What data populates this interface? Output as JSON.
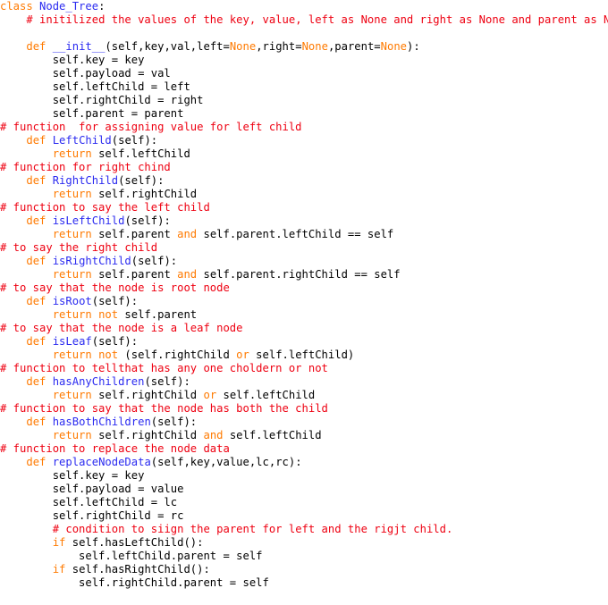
{
  "editor": {
    "language": "python",
    "colors": {
      "keyword": "#ff7a00",
      "function_name": "#2b2bf0",
      "comment": "#ee0011",
      "text": "#000000",
      "background": "#ffffff"
    },
    "lines": [
      [
        [
          "kw",
          "class "
        ],
        [
          "fn",
          "Node_Tree"
        ],
        [
          "tx",
          ":"
        ]
      ],
      [
        [
          "tx",
          "    "
        ],
        [
          "cm",
          "# initilized the values of the key, value, left as None and right as None and parent as None"
        ]
      ],
      [],
      [
        [
          "tx",
          "    "
        ],
        [
          "kw",
          "def "
        ],
        [
          "fn",
          "__init__"
        ],
        [
          "tx",
          "(self,key,val,left="
        ],
        [
          "kw",
          "None"
        ],
        [
          "tx",
          ",right="
        ],
        [
          "kw",
          "None"
        ],
        [
          "tx",
          ",parent="
        ],
        [
          "kw",
          "None"
        ],
        [
          "tx",
          "):"
        ]
      ],
      [
        [
          "tx",
          "        self.key = key"
        ]
      ],
      [
        [
          "tx",
          "        self.payload = val"
        ]
      ],
      [
        [
          "tx",
          "        self.leftChild = left"
        ]
      ],
      [
        [
          "tx",
          "        self.rightChild = right"
        ]
      ],
      [
        [
          "tx",
          "        self.parent = parent"
        ]
      ],
      [
        [
          "cm",
          "# function  for assigning value for left child"
        ]
      ],
      [
        [
          "tx",
          "    "
        ],
        [
          "kw",
          "def "
        ],
        [
          "fn",
          "LeftChild"
        ],
        [
          "tx",
          "(self):"
        ]
      ],
      [
        [
          "tx",
          "        "
        ],
        [
          "kw",
          "return"
        ],
        [
          "tx",
          " self.leftChild"
        ]
      ],
      [
        [
          "cm",
          "# function for right chind"
        ]
      ],
      [
        [
          "tx",
          "    "
        ],
        [
          "kw",
          "def "
        ],
        [
          "fn",
          "RightChild"
        ],
        [
          "tx",
          "(self):"
        ]
      ],
      [
        [
          "tx",
          "        "
        ],
        [
          "kw",
          "return"
        ],
        [
          "tx",
          " self.rightChild"
        ]
      ],
      [
        [
          "cm",
          "# function to say the left child"
        ]
      ],
      [
        [
          "tx",
          "    "
        ],
        [
          "kw",
          "def "
        ],
        [
          "fn",
          "isLeftChild"
        ],
        [
          "tx",
          "(self):"
        ]
      ],
      [
        [
          "tx",
          "        "
        ],
        [
          "kw",
          "return"
        ],
        [
          "tx",
          " self.parent "
        ],
        [
          "kw",
          "and"
        ],
        [
          "tx",
          " self.parent.leftChild == self"
        ]
      ],
      [
        [
          "cm",
          "# to say the right child"
        ]
      ],
      [
        [
          "tx",
          "    "
        ],
        [
          "kw",
          "def "
        ],
        [
          "fn",
          "isRightChild"
        ],
        [
          "tx",
          "(self):"
        ]
      ],
      [
        [
          "tx",
          "        "
        ],
        [
          "kw",
          "return"
        ],
        [
          "tx",
          " self.parent "
        ],
        [
          "kw",
          "and"
        ],
        [
          "tx",
          " self.parent.rightChild == self"
        ]
      ],
      [
        [
          "cm",
          "# to say that the node is root node"
        ]
      ],
      [
        [
          "tx",
          "    "
        ],
        [
          "kw",
          "def "
        ],
        [
          "fn",
          "isRoot"
        ],
        [
          "tx",
          "(self):"
        ]
      ],
      [
        [
          "tx",
          "        "
        ],
        [
          "kw",
          "return not"
        ],
        [
          "tx",
          " self.parent"
        ]
      ],
      [
        [
          "cm",
          "# to say that the node is a leaf node"
        ]
      ],
      [
        [
          "tx",
          "    "
        ],
        [
          "kw",
          "def "
        ],
        [
          "fn",
          "isLeaf"
        ],
        [
          "tx",
          "(self):"
        ]
      ],
      [
        [
          "tx",
          "        "
        ],
        [
          "kw",
          "return not"
        ],
        [
          "tx",
          " (self.rightChild "
        ],
        [
          "kw",
          "or"
        ],
        [
          "tx",
          " self.leftChild)"
        ]
      ],
      [
        [
          "cm",
          "# function to tellthat has any one choldern or not"
        ]
      ],
      [
        [
          "tx",
          "    "
        ],
        [
          "kw",
          "def "
        ],
        [
          "fn",
          "hasAnyChildren"
        ],
        [
          "tx",
          "(self):"
        ]
      ],
      [
        [
          "tx",
          "        "
        ],
        [
          "kw",
          "return"
        ],
        [
          "tx",
          " self.rightChild "
        ],
        [
          "kw",
          "or"
        ],
        [
          "tx",
          " self.leftChild"
        ]
      ],
      [
        [
          "cm",
          "# function to say that the node has both the child"
        ]
      ],
      [
        [
          "tx",
          "    "
        ],
        [
          "kw",
          "def "
        ],
        [
          "fn",
          "hasBothChildren"
        ],
        [
          "tx",
          "(self):"
        ]
      ],
      [
        [
          "tx",
          "        "
        ],
        [
          "kw",
          "return"
        ],
        [
          "tx",
          " self.rightChild "
        ],
        [
          "kw",
          "and"
        ],
        [
          "tx",
          " self.leftChild"
        ]
      ],
      [
        [
          "cm",
          "# function to replace the node data"
        ]
      ],
      [
        [
          "tx",
          "    "
        ],
        [
          "kw",
          "def "
        ],
        [
          "fn",
          "replaceNodeData"
        ],
        [
          "tx",
          "(self,key,value,lc,rc):"
        ]
      ],
      [
        [
          "tx",
          "        self.key = key"
        ]
      ],
      [
        [
          "tx",
          "        self.payload = value"
        ]
      ],
      [
        [
          "tx",
          "        self.leftChild = lc"
        ]
      ],
      [
        [
          "tx",
          "        self.rightChild = rc"
        ]
      ],
      [
        [
          "tx",
          "        "
        ],
        [
          "cm",
          "# condition to siign the parent for left and the rigjt child."
        ]
      ],
      [
        [
          "tx",
          "        "
        ],
        [
          "kw",
          "if"
        ],
        [
          "tx",
          " self.hasLeftChild():"
        ]
      ],
      [
        [
          "tx",
          "            self.leftChild.parent = self"
        ]
      ],
      [
        [
          "tx",
          "        "
        ],
        [
          "kw",
          "if"
        ],
        [
          "tx",
          " self.hasRightChild():"
        ]
      ],
      [
        [
          "tx",
          "            self.rightChild.parent = self"
        ]
      ]
    ]
  }
}
